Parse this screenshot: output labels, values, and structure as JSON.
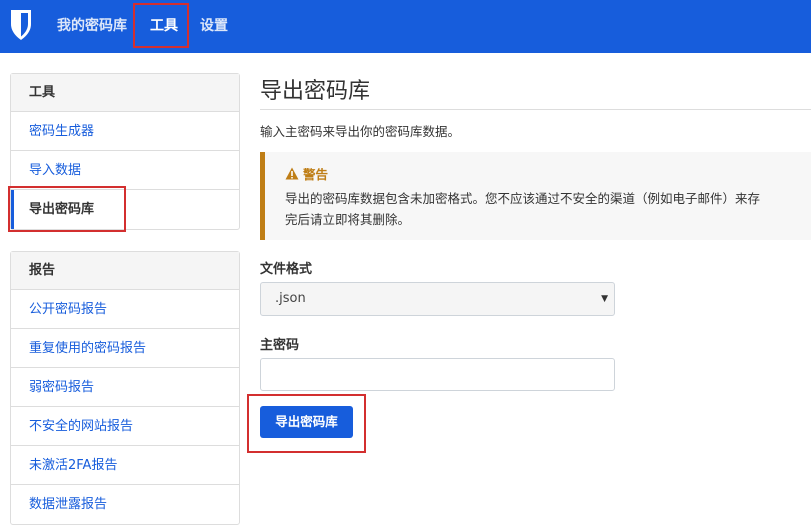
{
  "topbar": {
    "nav": [
      {
        "label": "我的密码库"
      },
      {
        "label": "工具"
      },
      {
        "label": "设置"
      }
    ]
  },
  "sidebar": {
    "tools": {
      "heading": "工具",
      "items": [
        {
          "label": "密码生成器"
        },
        {
          "label": "导入数据"
        },
        {
          "label": "导出密码库"
        }
      ]
    },
    "reports": {
      "heading": "报告",
      "items": [
        {
          "label": "公开密码报告"
        },
        {
          "label": "重复使用的密码报告"
        },
        {
          "label": "弱密码报告"
        },
        {
          "label": "不安全的网站报告"
        },
        {
          "label": "未激活2FA报告"
        },
        {
          "label": "数据泄露报告"
        }
      ]
    }
  },
  "main": {
    "title": "导出密码库",
    "description": "输入主密码来导出你的密码库数据。",
    "warning": {
      "title": "警告",
      "line1": "导出的密码库数据包含未加密格式。您不应该通过不安全的渠道（例如电子邮件）来存",
      "line2": "完后请立即将其删除。"
    },
    "format_label": "文件格式",
    "format_value": ".json",
    "password_label": "主密码",
    "password_value": "",
    "submit_label": "导出密码库"
  },
  "colors": {
    "brand": "#175ddc",
    "warning": "#bf7e16",
    "highlight": "#d32f2f"
  }
}
